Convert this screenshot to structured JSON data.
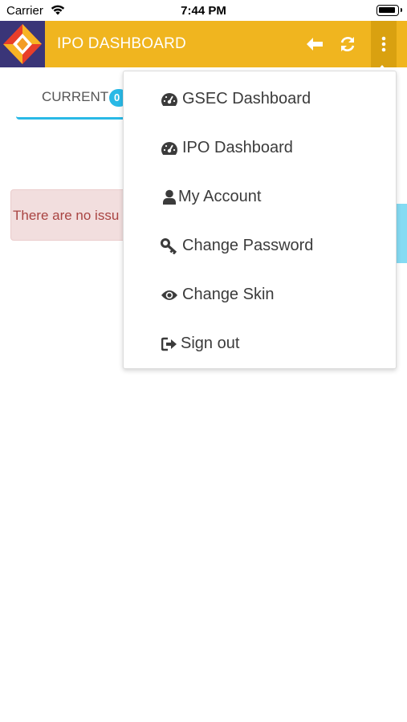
{
  "status_bar": {
    "carrier": "Carrier",
    "time": "7:44 PM"
  },
  "header": {
    "title": "IPO DASHBOARD",
    "background_color": "#f0b51f",
    "icons": [
      "back-arrow-icon",
      "refresh-icon",
      "more-vertical-icon"
    ]
  },
  "tabs": [
    {
      "label": "CURRENT",
      "badge": "0",
      "active": true
    }
  ],
  "alert": {
    "text": "There are no issu",
    "color": "#a94442"
  },
  "dropdown_menu": {
    "items": [
      {
        "label": "GSEC Dashboard",
        "icon": "dashboard-icon"
      },
      {
        "label": "IPO Dashboard",
        "icon": "dashboard-icon"
      },
      {
        "label": "My Account",
        "icon": "user-icon"
      },
      {
        "label": "Change Password",
        "icon": "key-icon"
      },
      {
        "label": "Change Skin",
        "icon": "eye-icon"
      },
      {
        "label": "Sign out",
        "icon": "sign-out-icon"
      }
    ]
  },
  "colors": {
    "accent": "#29b9e6",
    "header": "#f0b51f",
    "logo_bg": "#3a3578"
  }
}
